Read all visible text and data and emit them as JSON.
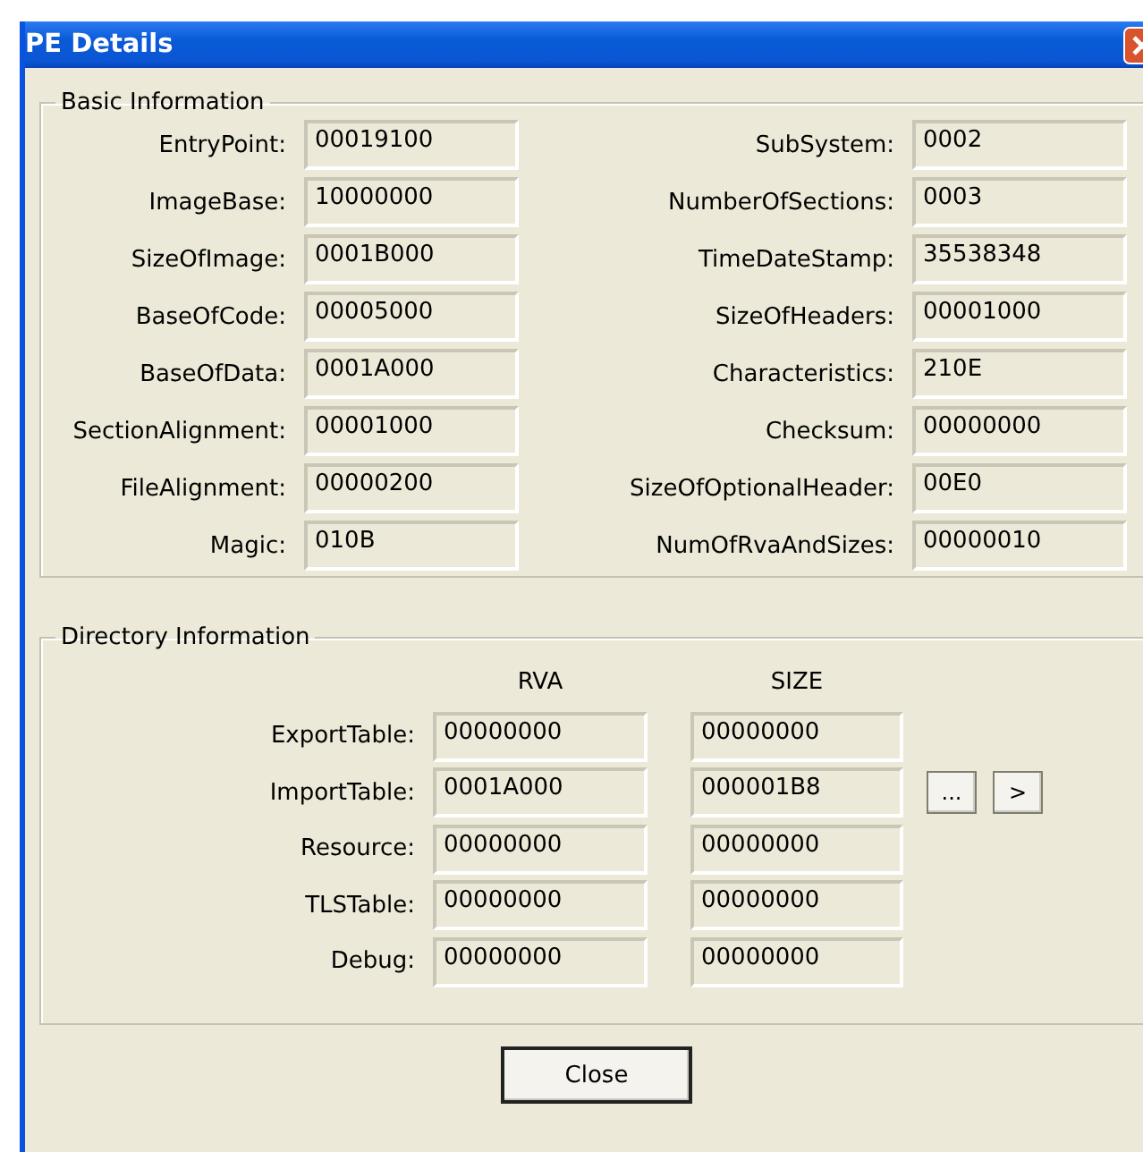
{
  "window": {
    "title": "PE Details"
  },
  "basic_information": {
    "title": "Basic Information",
    "left_fields": [
      {
        "label": "EntryPoint:",
        "value": "00019100"
      },
      {
        "label": "ImageBase:",
        "value": "10000000"
      },
      {
        "label": "SizeOfImage:",
        "value": "0001B000"
      },
      {
        "label": "BaseOfCode:",
        "value": "00005000"
      },
      {
        "label": "BaseOfData:",
        "value": "0001A000"
      },
      {
        "label": "SectionAlignment:",
        "value": "00001000"
      },
      {
        "label": "FileAlignment:",
        "value": "00000200"
      },
      {
        "label": "Magic:",
        "value": "010B"
      }
    ],
    "right_fields": [
      {
        "label": "SubSystem:",
        "value": "0002"
      },
      {
        "label": "NumberOfSections:",
        "value": "0003"
      },
      {
        "label": "TimeDateStamp:",
        "value": "35538348"
      },
      {
        "label": "SizeOfHeaders:",
        "value": "00001000"
      },
      {
        "label": "Characteristics:",
        "value": "210E"
      },
      {
        "label": "Checksum:",
        "value": "00000000"
      },
      {
        "label": "SizeOfOptionalHeader:",
        "value": "00E0"
      },
      {
        "label": "NumOfRvaAndSizes:",
        "value": "00000010"
      }
    ]
  },
  "directory_information": {
    "title": "Directory Information",
    "columns": [
      "RVA",
      "SIZE"
    ],
    "rows": [
      {
        "label": "ExportTable:",
        "rva": "00000000",
        "size": "00000000"
      },
      {
        "label": "ImportTable:",
        "rva": "0001A000",
        "size": "000001B8"
      },
      {
        "label": "Resource:",
        "rva": "00000000",
        "size": "00000000"
      },
      {
        "label": "TLSTable:",
        "rva": "00000000",
        "size": "00000000"
      },
      {
        "label": "Debug:",
        "rva": "00000000",
        "size": "00000000"
      }
    ],
    "buttons": [
      "...",
      ">"
    ]
  },
  "close_button": "Close"
}
